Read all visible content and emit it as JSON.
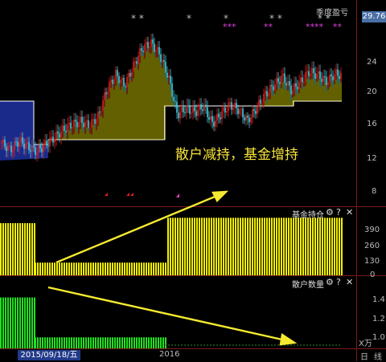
{
  "main_panel": {
    "title": "季度盈亏",
    "current_price": "29.76",
    "y_ticks": [
      "24",
      "20",
      "16",
      "12",
      "8"
    ],
    "annotation": "散户减持，基金增持",
    "stars_group_1": "* *",
    "stars_group_2": "*",
    "stars_group_3": "*",
    "stars_group_4": "* *",
    "stars_group_5": "* *",
    "magenta_markers": [
      "***",
      "**",
      "****",
      "**"
    ]
  },
  "fund_panel": {
    "title": "基金持仓",
    "y_ticks": [
      "390",
      "260",
      "130",
      "0"
    ]
  },
  "retail_panel": {
    "title": "散户数量",
    "y_ticks": [
      "1.4",
      "1.2",
      "1.0"
    ],
    "unit": "X万"
  },
  "panel_icons": [
    "gear-icon",
    "help-icon",
    "close-icon"
  ],
  "footer": {
    "date": "2015/09/18/五",
    "year_label": "2016",
    "day_label": "日",
    "line_label": "线"
  },
  "colors": {
    "background": "#000000",
    "up_candle": "#e02020",
    "down_candle": "#40d0e0",
    "yellow": "#f5f200",
    "blue_fill": "#1a2a8a",
    "green": "#20e020",
    "arrow": "#f5ea30"
  },
  "chart_data": [
    {
      "type": "line",
      "panel": "main",
      "description_series": "price candles",
      "ylim": [
        6,
        30
      ],
      "x": [
        0,
        1,
        2,
        3,
        4,
        5,
        6,
        7,
        8,
        9,
        10,
        11,
        12,
        13,
        14,
        15,
        16,
        17,
        18,
        19,
        20,
        21,
        22,
        23,
        24,
        25,
        26,
        27,
        28,
        29,
        30,
        31,
        32,
        33,
        34,
        35,
        36,
        37,
        38,
        39
      ],
      "close": [
        13.5,
        12.6,
        13.8,
        13.0,
        12.4,
        13.3,
        14.2,
        15.2,
        15.9,
        16.3,
        15.8,
        17.0,
        20.5,
        22.4,
        21.0,
        23.5,
        25.8,
        26.5,
        25.0,
        22.0,
        17.2,
        18.0,
        17.5,
        18.3,
        16.0,
        17.3,
        18.5,
        17.8,
        16.4,
        18.0,
        19.8,
        21.0,
        22.1,
        20.3,
        21.4,
        22.8,
        22.3,
        21.5,
        22.5,
        22.2
      ]
    },
    {
      "type": "bar",
      "panel": "fund",
      "ylim": [
        0,
        450
      ],
      "segments": [
        {
          "from": 0,
          "to": 42,
          "value": 390
        },
        {
          "from": 43,
          "to": 207,
          "value": 95
        },
        {
          "from": 208,
          "to": 425,
          "value": 430
        }
      ]
    },
    {
      "type": "bar",
      "panel": "retail",
      "ylim": [
        0.9,
        1.6
      ],
      "segments": [
        {
          "from": 0,
          "to": 42,
          "value": 1.5
        },
        {
          "from": 43,
          "to": 207,
          "value": 1.03
        },
        {
          "from": 208,
          "to": 425,
          "value": 0.95
        }
      ]
    }
  ]
}
